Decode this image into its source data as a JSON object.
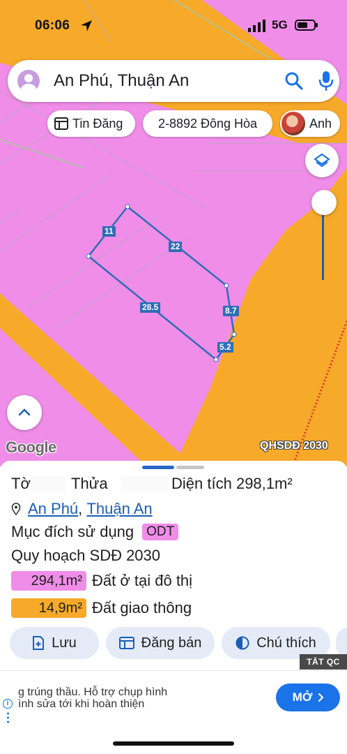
{
  "status_bar": {
    "time": "06:06",
    "network": "5G"
  },
  "search": {
    "text": "An Phú, Thuận An"
  },
  "chips": {
    "listing": "Tin Đăng",
    "parcel": "2-8892 Đông Hòa",
    "user": "Anh"
  },
  "map": {
    "logo": "Google",
    "layer_label": "QHSDĐ 2030",
    "colors": {
      "residential": "#ef8de8",
      "transport": "#f7a92a",
      "parcel_outline": "#2f6db5"
    },
    "dimensions": [
      "11",
      "22",
      "28.5",
      "8.7",
      "5.2"
    ]
  },
  "sheet": {
    "sheet_label": "Tờ",
    "plot_label": "Thửa",
    "area_label": "Diện tích",
    "area_value": "298,1m²",
    "location": {
      "ward": "An Phú",
      "separator": ",",
      "district": "Thuận An"
    },
    "usage_label": "Mục đích sử dụng",
    "usage_code": "ODT",
    "plan_label": "Quy hoạch SDĐ 2030",
    "plan_items": [
      {
        "area": "294,1m²",
        "label": "Đất ở tại đô thị",
        "color": "#ef8de8"
      },
      {
        "area": "14,9m²",
        "label": "Đất giao thông",
        "color": "#f7a92a"
      }
    ]
  },
  "actions": {
    "save": "Lưu",
    "post": "Đăng bán",
    "legend": "Chú thích"
  },
  "ad": {
    "tag": "TẮT QC",
    "line1": "g trúng thầu. Hỗ trợ chụp hình",
    "line2": "ình sửa tới khi hoàn thiện",
    "cta": "MỞ"
  }
}
